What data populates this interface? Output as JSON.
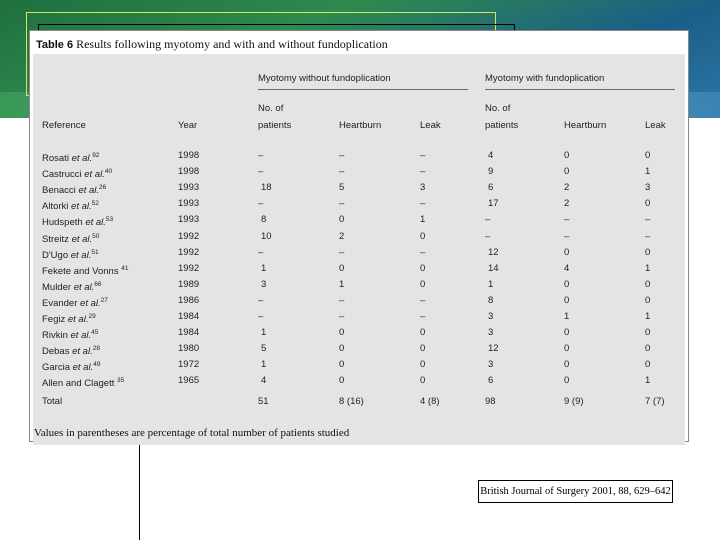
{
  "table": {
    "label": "Table 6",
    "title": "Results following myotomy and with and without fundoplication",
    "group_without": "Myotomy without fundoplication",
    "group_with": "Myotomy with fundoplication",
    "columns": {
      "reference": "Reference",
      "year": "Year",
      "patients": [
        "No. of",
        "patients"
      ],
      "heartburn": "Heartburn",
      "leak": "Leak"
    },
    "rows": [
      {
        "ref": "Rosati",
        "etal": true,
        "sup": "92",
        "year": "1998",
        "wo": [
          "–",
          "–",
          "–"
        ],
        "w": [
          "4",
          "0",
          "0"
        ]
      },
      {
        "ref": "Castrucci",
        "etal": true,
        "sup": "40",
        "year": "1998",
        "wo": [
          "–",
          "–",
          "–"
        ],
        "w": [
          "9",
          "0",
          "1"
        ]
      },
      {
        "ref": "Benacci",
        "etal": true,
        "sup": "26",
        "year": "1993",
        "wo": [
          "18",
          "5",
          "3"
        ],
        "w": [
          "6",
          "2",
          "3"
        ]
      },
      {
        "ref": "Altorki",
        "etal": true,
        "sup": "52",
        "year": "1993",
        "wo": [
          "–",
          "–",
          "–"
        ],
        "w": [
          "17",
          "2",
          "0"
        ]
      },
      {
        "ref": "Hudspeth",
        "etal": true,
        "sup": "53",
        "year": "1993",
        "wo": [
          "8",
          "0",
          "1"
        ],
        "w": [
          "–",
          "–",
          "–"
        ]
      },
      {
        "ref": "Streitz",
        "etal": true,
        "sup": "50",
        "year": "1992",
        "wo": [
          "10",
          "2",
          "0"
        ],
        "w": [
          "–",
          "–",
          "–"
        ]
      },
      {
        "ref": "D'Ugo",
        "etal": true,
        "sup": "51",
        "year": "1992",
        "wo": [
          "–",
          "–",
          "–"
        ],
        "w": [
          "12",
          "0",
          "0"
        ]
      },
      {
        "ref": "Fekete and Vonns",
        "etal": false,
        "sup": "41",
        "year": "1992",
        "wo": [
          "1",
          "0",
          "0"
        ],
        "w": [
          "14",
          "4",
          "1"
        ]
      },
      {
        "ref": "Mulder",
        "etal": true,
        "sup": "66",
        "year": "1989",
        "wo": [
          "3",
          "1",
          "0"
        ],
        "w": [
          "1",
          "0",
          "0"
        ]
      },
      {
        "ref": "Evander",
        "etal": true,
        "sup": "27",
        "year": "1986",
        "wo": [
          "–",
          "–",
          "–"
        ],
        "w": [
          "8",
          "0",
          "0"
        ]
      },
      {
        "ref": "Fegiz",
        "etal": true,
        "sup": "29",
        "year": "1984",
        "wo": [
          "–",
          "–",
          "–"
        ],
        "w": [
          "3",
          "1",
          "1"
        ]
      },
      {
        "ref": "Rivkin",
        "etal": true,
        "sup": "45",
        "year": "1984",
        "wo": [
          "1",
          "0",
          "0"
        ],
        "w": [
          "3",
          "0",
          "0"
        ]
      },
      {
        "ref": "Debas",
        "etal": true,
        "sup": "28",
        "year": "1980",
        "wo": [
          "5",
          "0",
          "0"
        ],
        "w": [
          "12",
          "0",
          "0"
        ]
      },
      {
        "ref": "Garcia",
        "etal": true,
        "sup": "49",
        "year": "1972",
        "wo": [
          "1",
          "0",
          "0"
        ],
        "w": [
          "3",
          "0",
          "0"
        ]
      },
      {
        "ref": "Allen and Clagett",
        "etal": false,
        "sup": "35",
        "year": "1965",
        "wo": [
          "4",
          "0",
          "0"
        ],
        "w": [
          "6",
          "0",
          "1"
        ]
      }
    ],
    "total": {
      "label": "Total",
      "wo": [
        "51",
        "8 (16)",
        "4 (8)"
      ],
      "w": [
        "98",
        "9 (9)",
        "7 (7)"
      ]
    },
    "footnote": "Values in parentheses are percentage of total number of patients studied"
  },
  "citation": "British Journal of Surgery 2001, 88, 629–642"
}
